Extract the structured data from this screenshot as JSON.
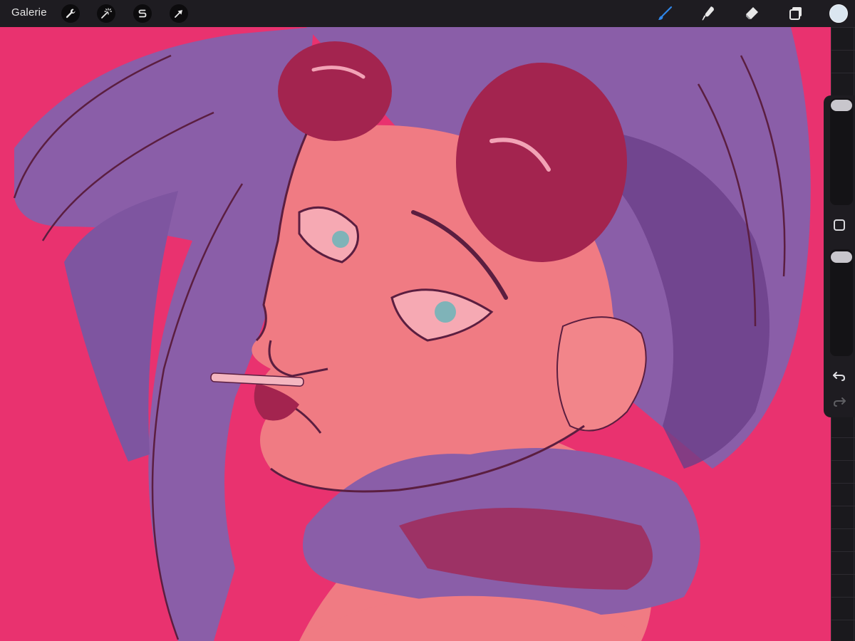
{
  "app": {
    "gallery_label": "Galerie"
  },
  "toolbar_left": [
    {
      "name": "actions",
      "icon": "wrench-icon"
    },
    {
      "name": "adjustments",
      "icon": "magic-wand-icon"
    },
    {
      "name": "selection",
      "icon": "selection-s-icon"
    },
    {
      "name": "transform",
      "icon": "arrow-cursor-icon"
    }
  ],
  "toolbar_right": [
    {
      "name": "brush",
      "icon": "brush-icon",
      "active": true
    },
    {
      "name": "smudge",
      "icon": "smudge-finger-icon",
      "active": false
    },
    {
      "name": "eraser",
      "icon": "eraser-icon",
      "active": false
    },
    {
      "name": "layers",
      "icon": "layers-icon",
      "active": false
    }
  ],
  "colors": {
    "background": "#e9326f",
    "hair": "#8a5ea8",
    "skin": "#f07b83",
    "dark": "#a3244f",
    "line": "#5b1e40",
    "accent_brush": "#2f86e8",
    "current_color": "#dbe6f0"
  },
  "sidebar": {
    "brush_size_level": 0.0,
    "opacity_level": 0.0,
    "undo_icon": "undo-icon",
    "redo_icon": "redo-icon"
  }
}
